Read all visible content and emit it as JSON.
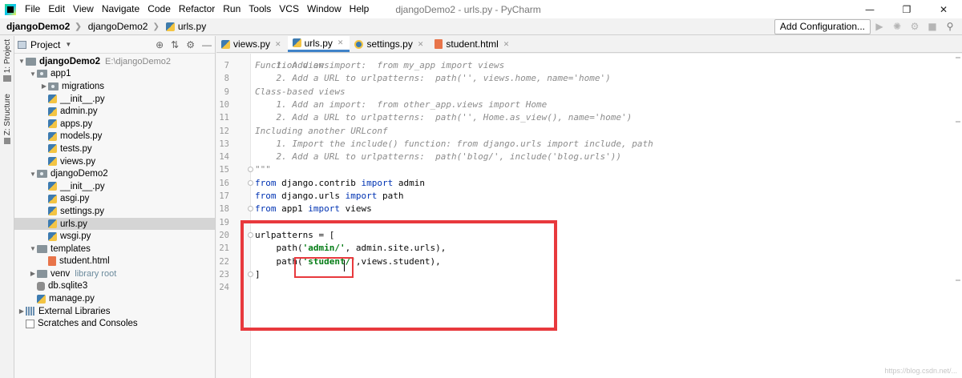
{
  "menubar": {
    "items": [
      "File",
      "Edit",
      "View",
      "Navigate",
      "Code",
      "Refactor",
      "Run",
      "Tools",
      "VCS",
      "Window",
      "Help"
    ],
    "window_title": "djangoDemo2 - urls.py - PyCharm"
  },
  "navbar": {
    "breadcrumbs": [
      "djangoDemo2",
      "djangoDemo2",
      "urls.py"
    ],
    "add_configuration": "Add Configuration..."
  },
  "left_strip": {
    "project_tab": "1: Project",
    "structure_tab": "Z: Structure"
  },
  "project_panel": {
    "title": "Project",
    "tree": [
      {
        "label": "djangoDemo2",
        "sub": "E:\\djangoDemo2",
        "type": "folder",
        "level": 0,
        "expanded": true,
        "bold": true
      },
      {
        "label": "app1",
        "type": "package",
        "level": 1,
        "expanded": true
      },
      {
        "label": "migrations",
        "type": "package",
        "level": 2,
        "expanded": false
      },
      {
        "label": "__init__.py",
        "type": "py",
        "level": 2
      },
      {
        "label": "admin.py",
        "type": "py",
        "level": 2
      },
      {
        "label": "apps.py",
        "type": "py",
        "level": 2
      },
      {
        "label": "models.py",
        "type": "py",
        "level": 2
      },
      {
        "label": "tests.py",
        "type": "py",
        "level": 2
      },
      {
        "label": "views.py",
        "type": "py",
        "level": 2
      },
      {
        "label": "djangoDemo2",
        "type": "package",
        "level": 1,
        "expanded": true
      },
      {
        "label": "__init__.py",
        "type": "py",
        "level": 2
      },
      {
        "label": "asgi.py",
        "type": "py",
        "level": 2
      },
      {
        "label": "settings.py",
        "type": "py",
        "level": 2
      },
      {
        "label": "urls.py",
        "type": "py",
        "level": 2,
        "selected": true
      },
      {
        "label": "wsgi.py",
        "type": "py",
        "level": 2
      },
      {
        "label": "templates",
        "type": "folder",
        "level": 1,
        "expanded": true
      },
      {
        "label": "student.html",
        "type": "html",
        "level": 2
      },
      {
        "label": "venv",
        "sub": "library root",
        "type": "venv",
        "level": 1,
        "expanded": false
      },
      {
        "label": "db.sqlite3",
        "type": "db",
        "level": 1
      },
      {
        "label": "manage.py",
        "type": "py",
        "level": 1
      },
      {
        "label": "External Libraries",
        "type": "lib",
        "level": 0,
        "expanded": false
      },
      {
        "label": "Scratches and Consoles",
        "type": "scratch",
        "level": 0
      }
    ]
  },
  "editor_tabs": [
    {
      "label": "views.py",
      "active": false
    },
    {
      "label": "urls.py",
      "active": true
    },
    {
      "label": "settings.py",
      "active": false
    },
    {
      "label": "student.html",
      "active": false
    }
  ],
  "editor": {
    "first_partial_line": "Function views",
    "lines": [
      {
        "n": "7",
        "segs": [
          [
            "cm",
            "    1. Add an import:  from my_app import views"
          ]
        ]
      },
      {
        "n": "8",
        "segs": [
          [
            "cm",
            "    2. Add a URL to urlpatterns:  path('', views.home, name='home')"
          ]
        ]
      },
      {
        "n": "9",
        "segs": [
          [
            "cm",
            "Class-based views"
          ]
        ]
      },
      {
        "n": "10",
        "segs": [
          [
            "cm",
            "    1. Add an import:  from other_app.views import Home"
          ]
        ]
      },
      {
        "n": "11",
        "segs": [
          [
            "cm",
            "    2. Add a URL to urlpatterns:  path('', Home.as_view(), name='home')"
          ]
        ]
      },
      {
        "n": "12",
        "segs": [
          [
            "cm",
            "Including another URLconf"
          ]
        ]
      },
      {
        "n": "13",
        "segs": [
          [
            "cm",
            "    1. Import the include() function: from django.urls import include, path"
          ]
        ]
      },
      {
        "n": "14",
        "segs": [
          [
            "cm",
            "    2. Add a URL to urlpatterns:  path('blog/', include('blog.urls'))"
          ]
        ]
      },
      {
        "n": "15",
        "segs": [
          [
            "cm",
            "\"\"\""
          ]
        ],
        "fold": true
      },
      {
        "n": "16",
        "segs": [
          [
            "kw",
            "from"
          ],
          [
            "plain",
            " django.contrib "
          ],
          [
            "kw",
            "import"
          ],
          [
            "plain",
            " admin"
          ]
        ],
        "fold": true
      },
      {
        "n": "17",
        "segs": [
          [
            "kw",
            "from"
          ],
          [
            "plain",
            " django.urls "
          ],
          [
            "kw",
            "import"
          ],
          [
            "plain",
            " path"
          ]
        ]
      },
      {
        "n": "18",
        "segs": [
          [
            "kw",
            "from"
          ],
          [
            "plain",
            " app1 "
          ],
          [
            "kw",
            "import"
          ],
          [
            "plain",
            " views"
          ]
        ],
        "fold": true
      },
      {
        "n": "19",
        "segs": []
      },
      {
        "n": "20",
        "segs": [
          [
            "plain",
            "urlpatterns = ["
          ]
        ],
        "fold": true
      },
      {
        "n": "21",
        "segs": [
          [
            "plain",
            "    path("
          ],
          [
            "str",
            "'admin/'"
          ],
          [
            "plain",
            ", admin.site.urls),"
          ]
        ]
      },
      {
        "n": "22",
        "segs": [
          [
            "plain",
            "    path("
          ],
          [
            "str",
            "'student/'"
          ],
          [
            "plain",
            ",views.student),"
          ]
        ]
      },
      {
        "n": "23",
        "segs": [
          [
            "plain",
            "]"
          ]
        ],
        "fold": true
      },
      {
        "n": "24",
        "segs": []
      }
    ]
  },
  "watermark": "https://blog.csdn.net/..."
}
